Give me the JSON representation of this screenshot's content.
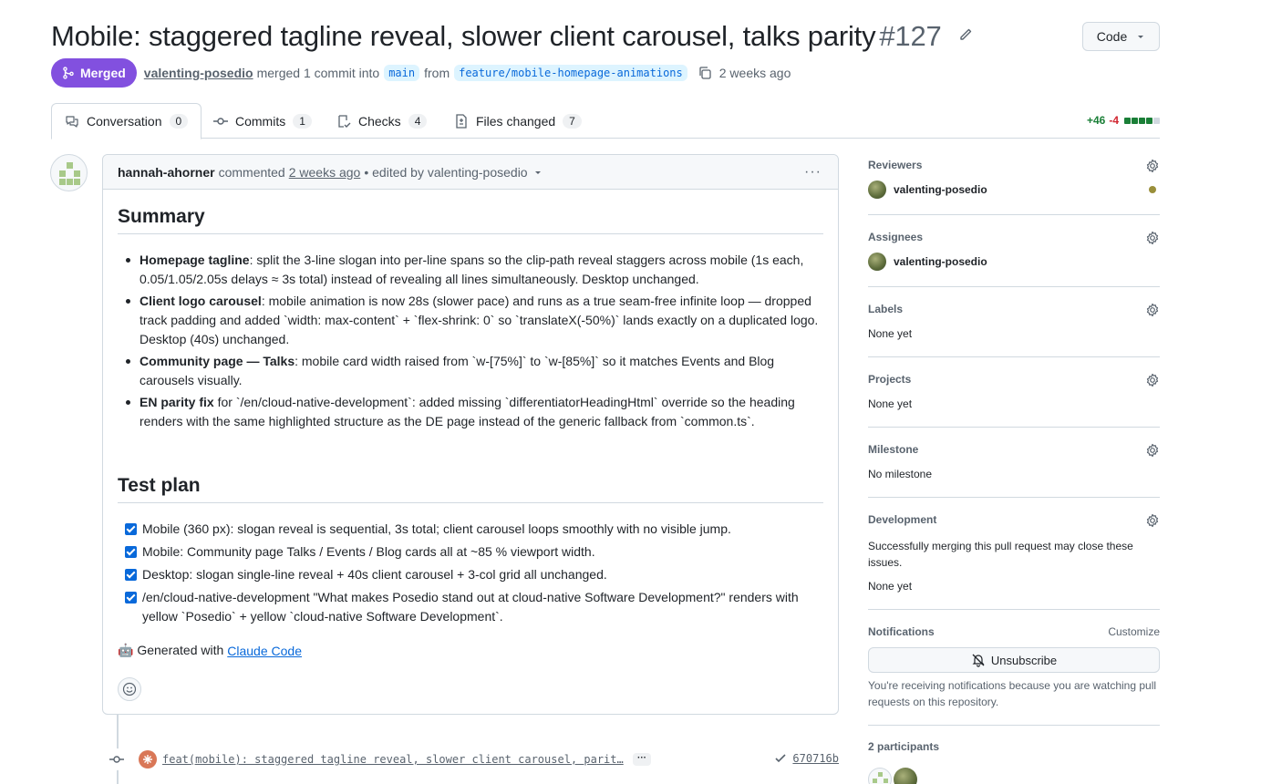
{
  "header": {
    "title": "Mobile: staggered tagline reveal, slower client carousel, talks parity",
    "number": "#127",
    "code_button": "Code"
  },
  "meta": {
    "status": "Merged",
    "user": "valenting-posedio",
    "action": "merged 1 commit into",
    "base_branch": "main",
    "from": "from",
    "head_branch": "feature/mobile-homepage-animations",
    "time": "2 weeks ago"
  },
  "tabs": [
    {
      "label": "Conversation",
      "count": "0"
    },
    {
      "label": "Commits",
      "count": "1"
    },
    {
      "label": "Checks",
      "count": "4"
    },
    {
      "label": "Files changed",
      "count": "7"
    }
  ],
  "diffstat": {
    "added": "+46",
    "removed": "-4"
  },
  "comment": {
    "author": "hannah-ahorner",
    "action": "commented",
    "time": "2 weeks ago",
    "edited": "• edited by valenting-posedio",
    "summary_heading": "Summary",
    "bullets": [
      {
        "bold": "Homepage tagline",
        "text": ": split the 3-line slogan into per-line spans so the clip-path reveal staggers across mobile (1s each, 0.05/1.05/2.05s delays ≈ 3s total) instead of revealing all lines simultaneously. Desktop unchanged."
      },
      {
        "bold": "Client logo carousel",
        "text": ": mobile animation is now 28s (slower pace) and runs as a true seam-free infinite loop — dropped track padding and added `width: max-content` + `flex-shrink: 0` so `translateX(-50%)` lands exactly on a duplicated logo. Desktop (40s) unchanged."
      },
      {
        "bold": "Community page — Talks",
        "text": ": mobile card width raised from `w-[75%]` to `w-[85%]` so it matches Events and Blog carousels visually."
      },
      {
        "bold": "EN parity fix",
        "text": " for `/en/cloud-native-development`: added missing `differentiatorHeadingHtml` override so the heading renders with the same highlighted structure as the DE page instead of the generic fallback from `common.ts`."
      }
    ],
    "test_heading": "Test plan",
    "tasks": [
      "Mobile (360 px): slogan reveal is sequential, 3s total; client carousel loops smoothly with no visible jump.",
      "Mobile: Community page Talks / Events / Blog cards all at ~85 % viewport width.",
      "Desktop: slogan single-line reveal + 40s client carousel + 3-col grid all unchanged.",
      "/en/cloud-native-development \"What makes Posedio stand out at cloud-native Software Development?\" renders with yellow `Posedio` + yellow `cloud-native Software Development`."
    ],
    "generated_prefix": "🤖 Generated with",
    "generated_link": "Claude Code"
  },
  "commit": {
    "message": "feat(mobile): staggered tagline reveal, slower client carousel, parit…",
    "more": "···",
    "sha": "670716b"
  },
  "sidebar": {
    "reviewers": {
      "title": "Reviewers",
      "user": "valenting-posedio"
    },
    "assignees": {
      "title": "Assignees",
      "user": "valenting-posedio"
    },
    "labels": {
      "title": "Labels",
      "value": "None yet"
    },
    "projects": {
      "title": "Projects",
      "value": "None yet"
    },
    "milestone": {
      "title": "Milestone",
      "value": "No milestone"
    },
    "development": {
      "title": "Development",
      "note": "Successfully merging this pull request may close these issues.",
      "value": "None yet"
    },
    "notifications": {
      "title": "Notifications",
      "customize": "Customize",
      "button": "Unsubscribe",
      "note": "You're receiving notifications because you are watching pull requests on this repository."
    },
    "participants": {
      "title": "2 participants"
    }
  },
  "colors": {
    "merged": "#8250df",
    "link": "#0969da",
    "add": "#1a7f37",
    "del": "#d1242f"
  }
}
